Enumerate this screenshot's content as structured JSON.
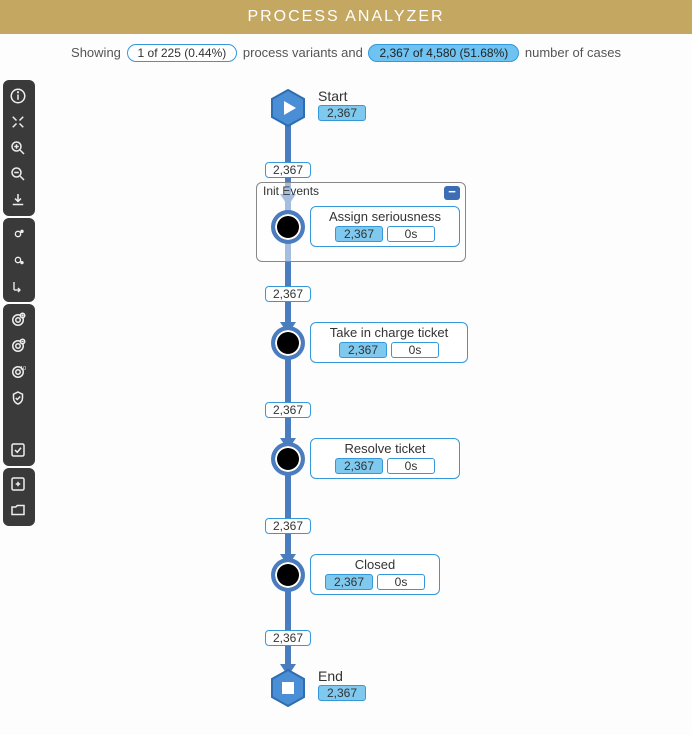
{
  "header": {
    "title": "PROCESS ANALYZER"
  },
  "subheader": {
    "showing": "Showing",
    "variants_pill": "1 of 225 (0.44%)",
    "mid": "process variants and",
    "cases_pill": "2,367 of 4,580 (51.68%)",
    "tail": "number of cases"
  },
  "group": {
    "title": "Init Events",
    "collapse_glyph": "−"
  },
  "nodes": {
    "start": {
      "label": "Start",
      "count": "2,367"
    },
    "assign": {
      "label": "Assign seriousness",
      "count": "2,367",
      "time": "0s"
    },
    "take": {
      "label": "Take in charge ticket",
      "count": "2,367",
      "time": "0s"
    },
    "resolve": {
      "label": "Resolve ticket",
      "count": "2,367",
      "time": "0s"
    },
    "closed": {
      "label": "Closed",
      "count": "2,367",
      "time": "0s"
    },
    "end": {
      "label": "End",
      "count": "2,367"
    }
  },
  "edges": {
    "e1": "2,367",
    "e2": "2,367",
    "e3": "2,367",
    "e4": "2,367",
    "e5": "2,367"
  }
}
